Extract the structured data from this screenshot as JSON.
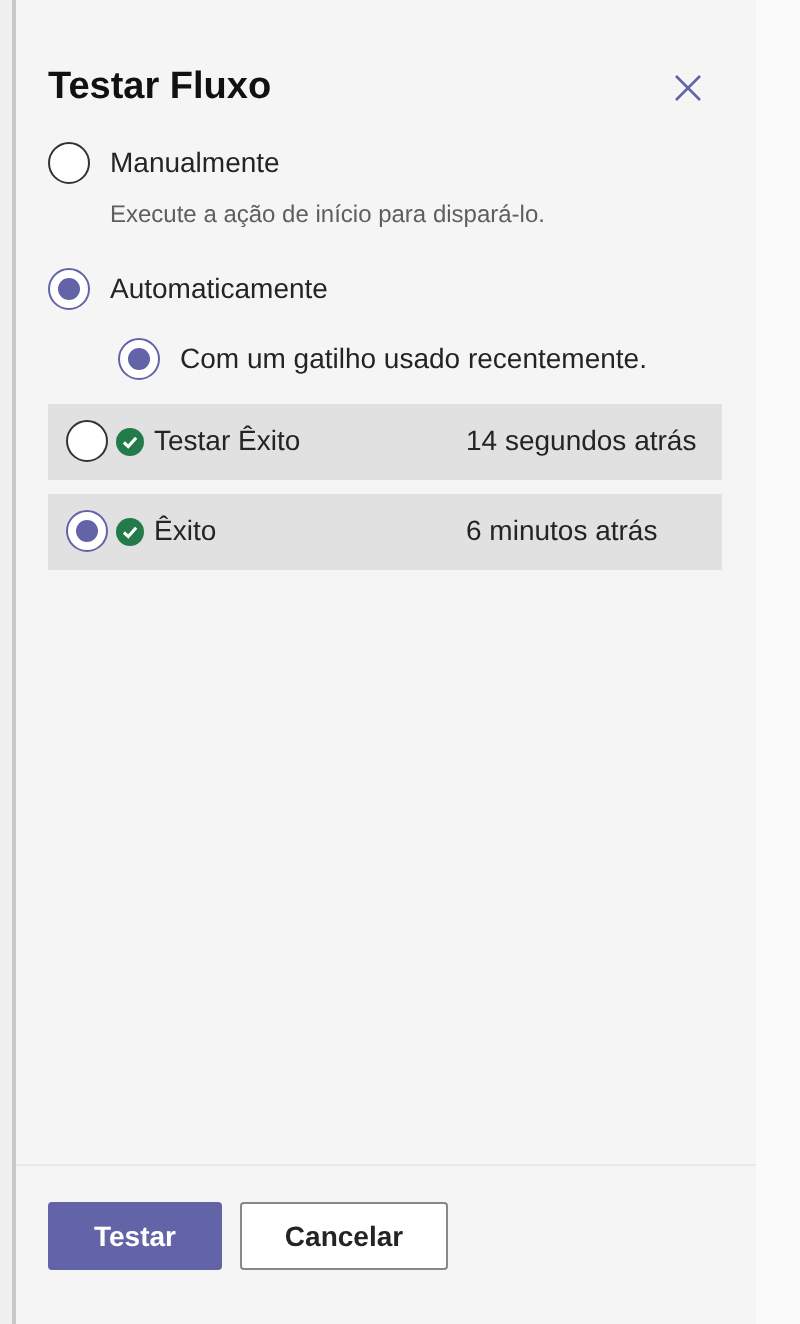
{
  "title": "Testar Fluxo",
  "options": [
    {
      "label": "Manualmente",
      "description": "Execute a ação de início para dispará-lo.",
      "selected": false
    },
    {
      "label": "Automaticamente",
      "selected": true
    }
  ],
  "sub_option": {
    "label": "Com um gatilho usado recentemente.",
    "selected": true
  },
  "runs": [
    {
      "name": "Testar Êxito",
      "time": "14 segundos atrás",
      "selected": false
    },
    {
      "name": "Êxito",
      "time": "6 minutos atrás",
      "selected": true
    }
  ],
  "buttons": [
    {
      "label": "Testar",
      "kind": "primary"
    },
    {
      "label": "Cancelar",
      "kind": "secondary"
    }
  ]
}
